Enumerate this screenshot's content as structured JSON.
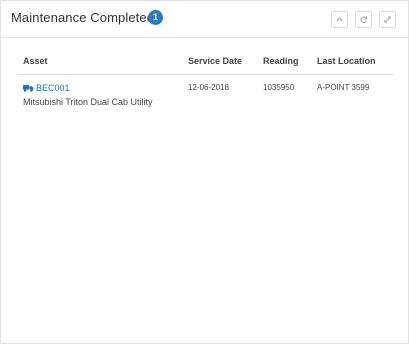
{
  "panel": {
    "title": "Maintenance Completed",
    "count": "1",
    "tools": {
      "collapse_icon": "chevron-up-icon",
      "refresh_icon": "refresh-icon",
      "expand_icon": "expand-icon"
    }
  },
  "table": {
    "columns": [
      "Asset",
      "Service Date",
      "Reading",
      "Last Location"
    ],
    "rows": [
      {
        "asset_icon": "truck-icon",
        "asset_id": "BEC001",
        "asset_name": "Mitsubishi Triton Dual Cab Utility",
        "service_date": "12-06-2018",
        "reading": "1035950",
        "last_location": "A-POINT 3599"
      }
    ]
  },
  "colors": {
    "badge": "#2a7ac4",
    "link": "#2a6fb8",
    "text": "#444444"
  }
}
